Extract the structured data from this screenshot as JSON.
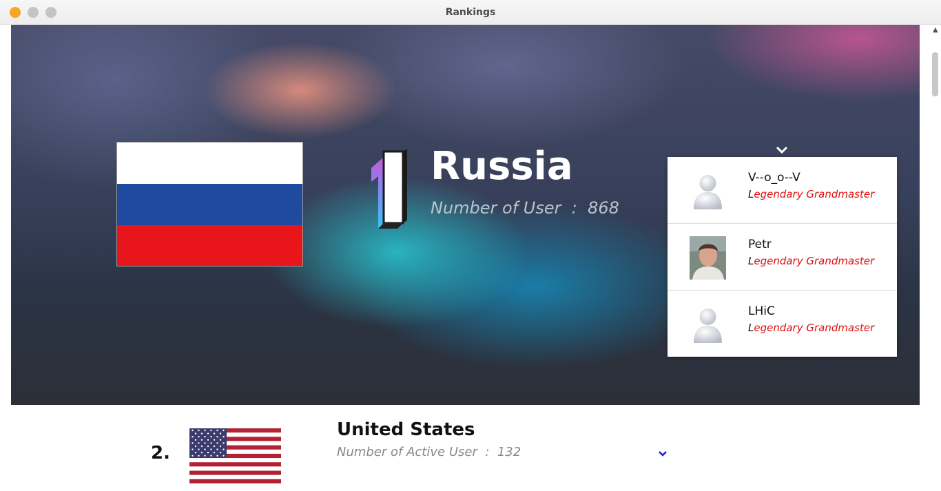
{
  "window": {
    "title": "Rankings"
  },
  "colors": {
    "russia_flag": [
      "#ffffff",
      "#1f4aa0",
      "#e8161b"
    ],
    "legendary_grandmaster": "#e01010",
    "chevron_blue": "#1a1adb"
  },
  "hero": {
    "rank": "1",
    "country": "Russia",
    "user_count_label": "Number of User",
    "separator": ":",
    "user_count": "868",
    "top_users": [
      {
        "name": "V--o_o--V",
        "rank_first_letter": "L",
        "rank_rest": "egendary Grandmaster",
        "avatar": "default-avatar-icon"
      },
      {
        "name": "Petr",
        "rank_first_letter": "L",
        "rank_rest": "egendary Grandmaster",
        "avatar": "user-photo"
      },
      {
        "name": "LHiC",
        "rank_first_letter": "L",
        "rank_rest": "egendary Grandmaster",
        "avatar": "default-avatar-icon"
      }
    ]
  },
  "second": {
    "rank": "2.",
    "country": "United States",
    "active_label": "Number of Active User",
    "separator": ":",
    "active_count": "132"
  }
}
